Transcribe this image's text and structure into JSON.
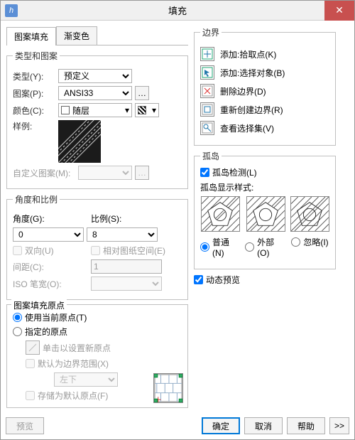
{
  "window": {
    "title": "填充",
    "app_icon_label": "h"
  },
  "tabs": {
    "hatch": "图案填充",
    "gradient": "渐变色"
  },
  "pattern_group": {
    "legend": "类型和图案",
    "type_label": "类型(Y):",
    "type_value": "预定义",
    "pattern_label": "图案(P):",
    "pattern_value": "ANSI33",
    "color_label": "颜色(C):",
    "color_value": "随层",
    "sample_label": "样例:",
    "custom_label": "自定义图案(M):"
  },
  "angle_group": {
    "legend": "角度和比例",
    "angle_label": "角度(G):",
    "angle_value": "0",
    "scale_label": "比例(S):",
    "scale_value": "8",
    "double_label": "双向(U)",
    "relpaper_label": "相对图纸空间(E)",
    "spacing_label": "间距(C):",
    "spacing_value": "1",
    "isopen_label": "ISO 笔宽(O):"
  },
  "origin_group": {
    "legend": "图案填充原点",
    "use_current": "使用当前原点(T)",
    "specified": "指定的原点",
    "click_set": "单击以设置新原点",
    "default_bounds": "默认为边界范围(X)",
    "position_value": "左下",
    "store_default": "存储为默认原点(F)"
  },
  "boundary_group": {
    "legend": "边界",
    "add_pick": "添加:拾取点(K)",
    "add_select": "添加:选择对象(B)",
    "delete": "删除边界(D)",
    "recreate": "重新创建边界(R)",
    "view_sel": "查看选择集(V)"
  },
  "island_group": {
    "legend": "孤岛",
    "detect": "孤岛检测(L)",
    "style_label": "孤岛显示样式:",
    "normal": "普通(N)",
    "outer": "外部(O)",
    "ignore": "忽略(I)"
  },
  "dynamic_preview": "动态预览",
  "footer": {
    "preview": "预览",
    "ok": "确定",
    "cancel": "取消",
    "help": "帮助",
    "expand": ">>"
  }
}
